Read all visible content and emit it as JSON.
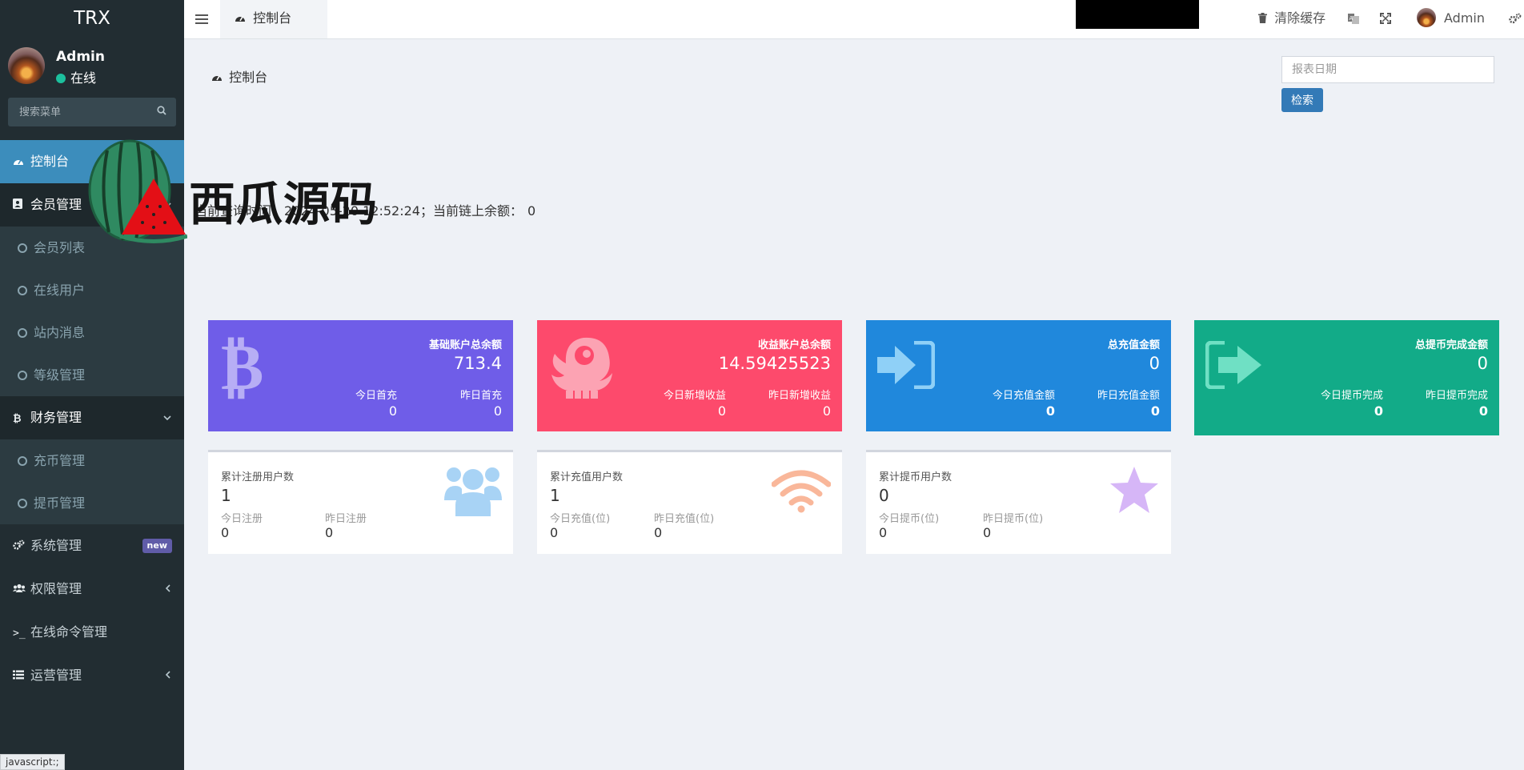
{
  "sidebar": {
    "brand": "TRX",
    "user": {
      "name": "Admin",
      "status": "在线"
    },
    "search_placeholder": "搜索菜单",
    "menu": [
      {
        "label": "控制台",
        "icon": "dashboard-icon",
        "active": true
      },
      {
        "label": "会员管理",
        "icon": "address-card-icon",
        "open": true,
        "children": [
          "会员列表",
          "在线用户",
          "站内消息",
          "等级管理"
        ]
      },
      {
        "label": "财务管理",
        "icon": "bitcoin-icon",
        "open": true,
        "children": [
          "充币管理",
          "提币管理"
        ]
      },
      {
        "label": "系统管理",
        "icon": "cogs-icon",
        "badge": "new"
      },
      {
        "label": "权限管理",
        "icon": "group-icon"
      },
      {
        "label": "在线命令管理",
        "icon": "terminal-icon"
      },
      {
        "label": "运营管理",
        "icon": "list-icon"
      }
    ],
    "status_bar": "javascript:;"
  },
  "header": {
    "tab": "控制台",
    "clear_cache": "清除缓存",
    "user": "Admin"
  },
  "content": {
    "breadcrumb": "控制台",
    "date_placeholder": "报表日期",
    "search_btn": "检索",
    "info_prefix": "当前查询时间：",
    "info_time": "2024-05-20 12:52:24",
    "info_balance_label": "；当前链上余额：",
    "info_balance": "0",
    "watermark": "西瓜源码",
    "cards": [
      {
        "title": "基础账户总余额",
        "value": "713.4",
        "sub1_label": "今日首充",
        "sub1_value": "0",
        "sub2_label": "昨日首充",
        "sub2_value": "0",
        "color": "#6f5de8",
        "icon": "bitcoin-icon"
      },
      {
        "title": "收益账户总余额",
        "value": "14.59425523",
        "sub1_label": "今日新增收益",
        "sub1_value": "0",
        "sub2_label": "昨日新增收益",
        "sub2_value": "0",
        "color": "#fd4a6c",
        "icon": "mascot-icon"
      },
      {
        "title": "总充值金额",
        "value": "0",
        "sub1_label": "今日充值金额",
        "sub1_value": "0",
        "sub2_label": "昨日充值金额",
        "sub2_value": "0",
        "color": "#2088dc",
        "icon": "sign-in-icon"
      },
      {
        "title": "总提币完成金额",
        "value": "0",
        "sub1_label": "今日提币完成",
        "sub1_value": "0",
        "sub2_label": "昨日提币完成",
        "sub2_value": "0",
        "color": "#12ab88",
        "icon": "sign-out-icon"
      }
    ],
    "boxes": [
      {
        "title": "累计注册用户数",
        "value": "1",
        "l1": "今日注册",
        "v1": "0",
        "l2": "昨日注册",
        "v2": "0",
        "icon": "users-icon"
      },
      {
        "title": "累计充值用户数",
        "value": "1",
        "l1": "今日充值(位)",
        "v1": "0",
        "l2": "昨日充值(位)",
        "v2": "0",
        "icon": "wifi-icon"
      },
      {
        "title": "累计提币用户数",
        "value": "0",
        "l1": "今日提币(位)",
        "v1": "0",
        "l2": "昨日提币(位)",
        "v2": "0",
        "icon": "star-icon"
      }
    ]
  }
}
